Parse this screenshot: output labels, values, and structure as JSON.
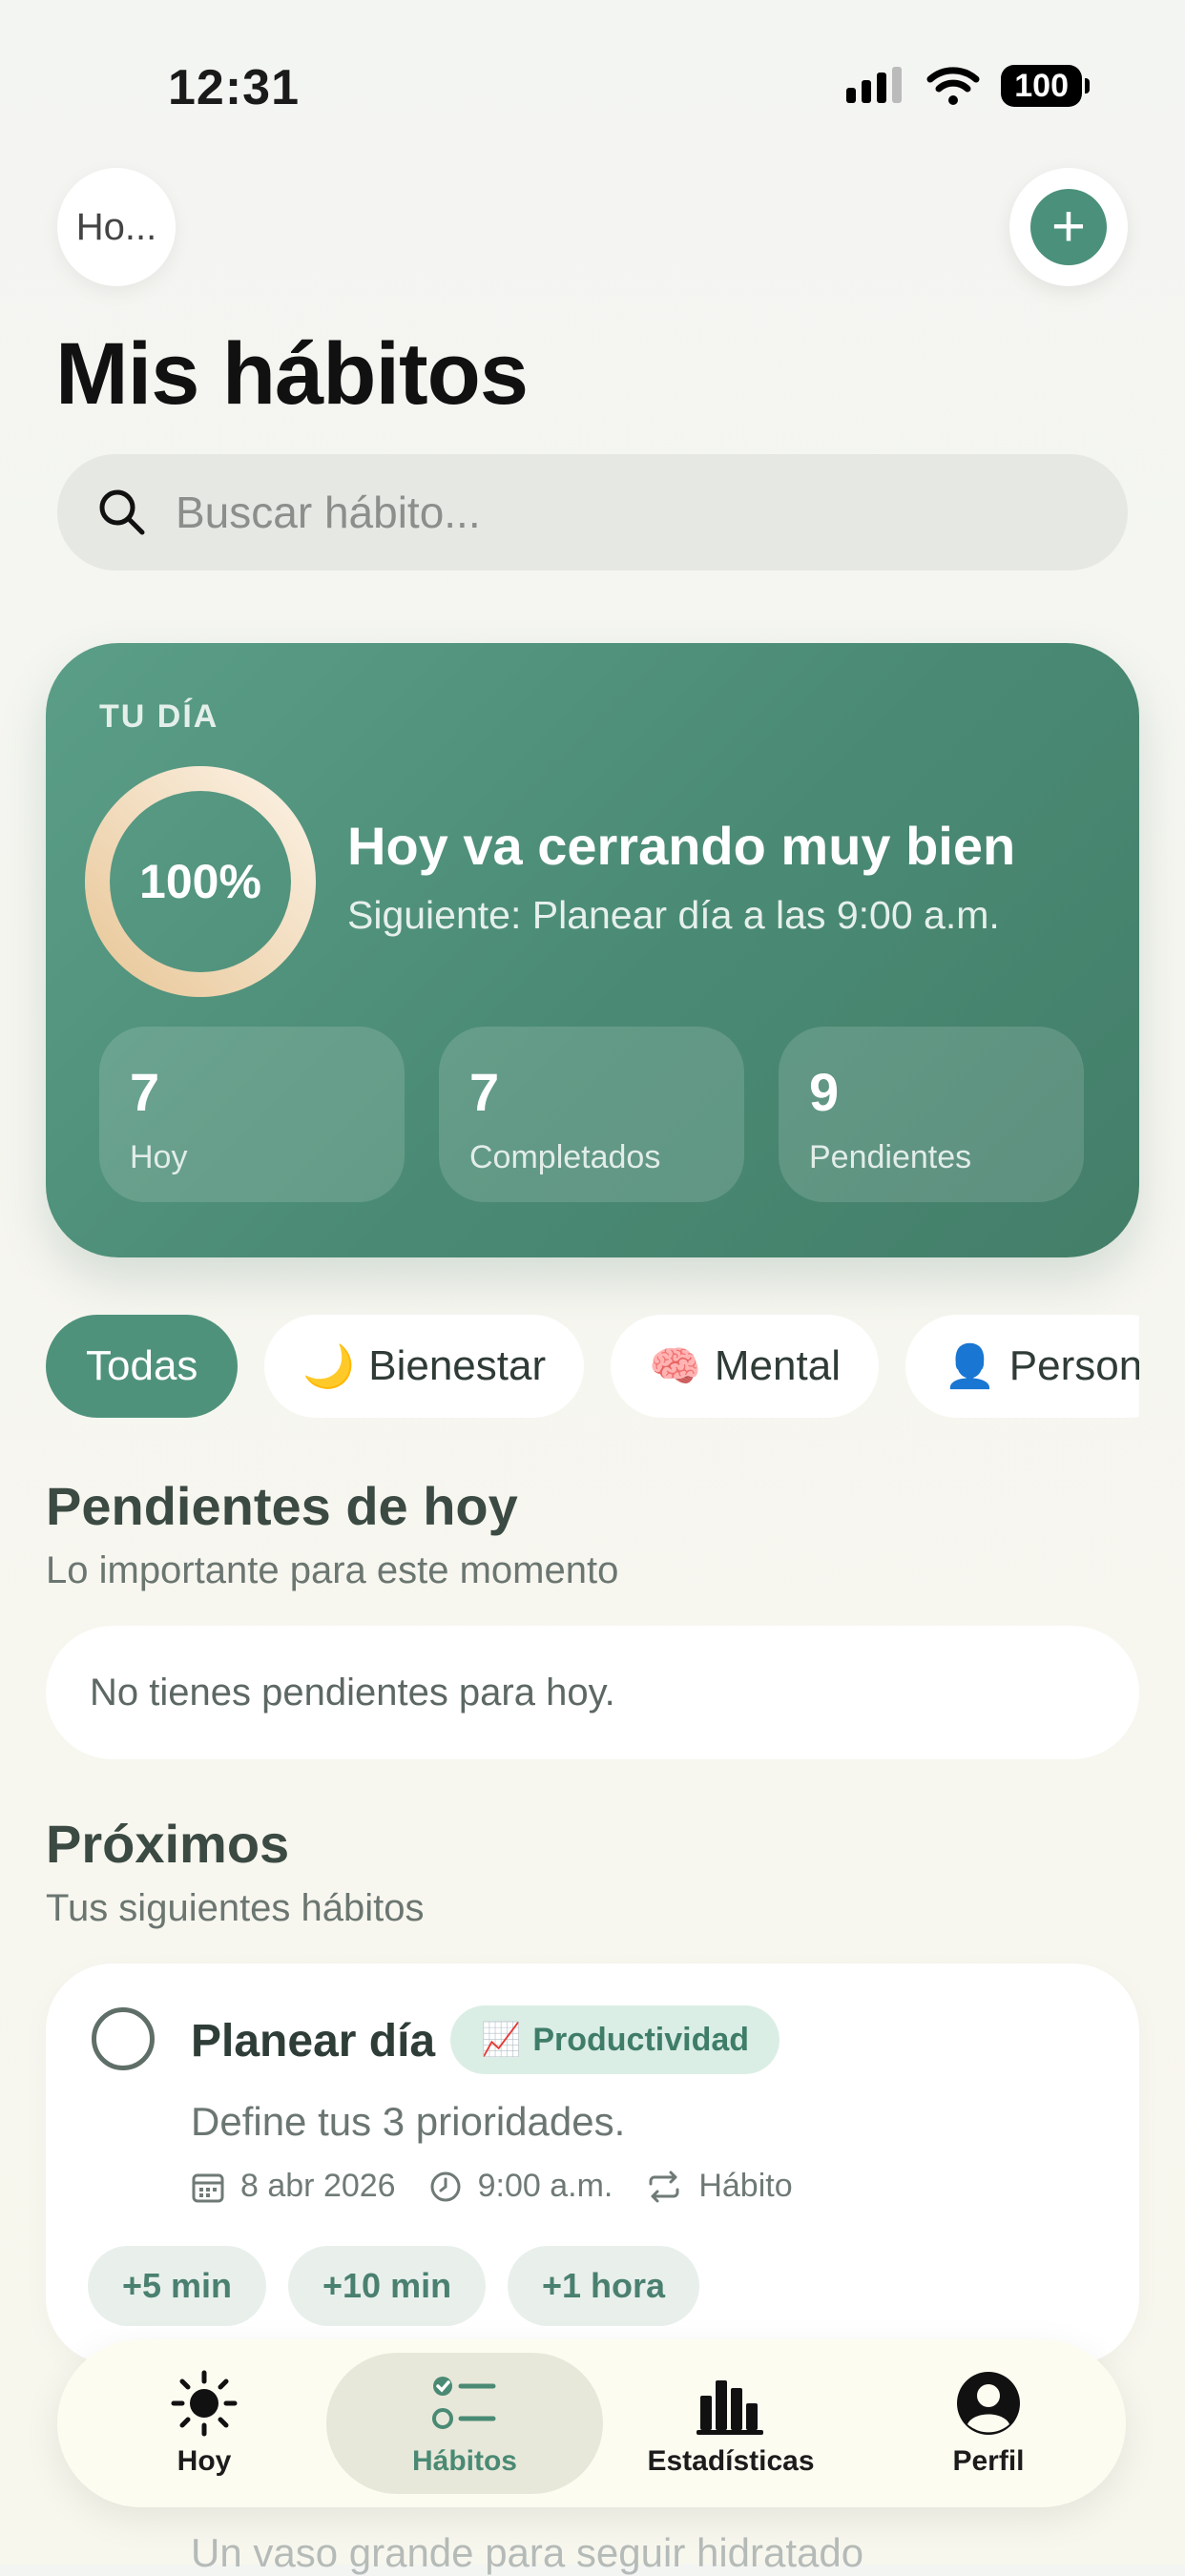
{
  "status_bar": {
    "time": "12:31",
    "battery": "100"
  },
  "header": {
    "back_label": "Ho...",
    "title": "Mis hábitos",
    "add_icon": "plus-icon"
  },
  "search": {
    "placeholder": "Buscar hábito..."
  },
  "summary": {
    "eyebrow": "TU DÍA",
    "progress_percent": 100,
    "progress_label": "100%",
    "headline": "Hoy va cerrando muy bien",
    "next": "Siguiente: Planear día a las 9:00 a.m.",
    "stats": [
      {
        "value": "7",
        "label": "Hoy"
      },
      {
        "value": "7",
        "label": "Completados"
      },
      {
        "value": "9",
        "label": "Pendientes"
      }
    ]
  },
  "filters": [
    {
      "emoji": "",
      "label": "Todas",
      "active": true
    },
    {
      "emoji": "🌙",
      "label": "Bienestar"
    },
    {
      "emoji": "🧠",
      "label": "Mental"
    },
    {
      "emoji": "👤",
      "label": "Person"
    }
  ],
  "pending": {
    "title": "Pendientes de hoy",
    "subtitle": "Lo importante para este momento",
    "empty": "No tienes pendientes para hoy."
  },
  "upcoming": {
    "title": "Próximos",
    "subtitle": "Tus siguientes hábitos",
    "habit": {
      "name": "Planear día",
      "tag_emoji": "📈",
      "tag": "Productividad",
      "description": "Define tus 3 prioridades.",
      "date": "8 abr 2026",
      "time": "9:00 a.m.",
      "type": "Hábito",
      "snooze": [
        "+5 min",
        "+10 min",
        "+1 hora"
      ]
    },
    "partial_description": "Un vaso grande para seguir hidratado"
  },
  "tabs": [
    {
      "label": "Hoy",
      "icon": "sun-icon"
    },
    {
      "label": "Hábitos",
      "icon": "checklist-icon",
      "active": true
    },
    {
      "label": "Estadísticas",
      "icon": "bar-chart-icon"
    },
    {
      "label": "Perfil",
      "icon": "user-icon"
    }
  ],
  "colors": {
    "accent": "#4a8a74",
    "ring_start": "#e9c89a",
    "ring_end": "#fbf3e6"
  }
}
